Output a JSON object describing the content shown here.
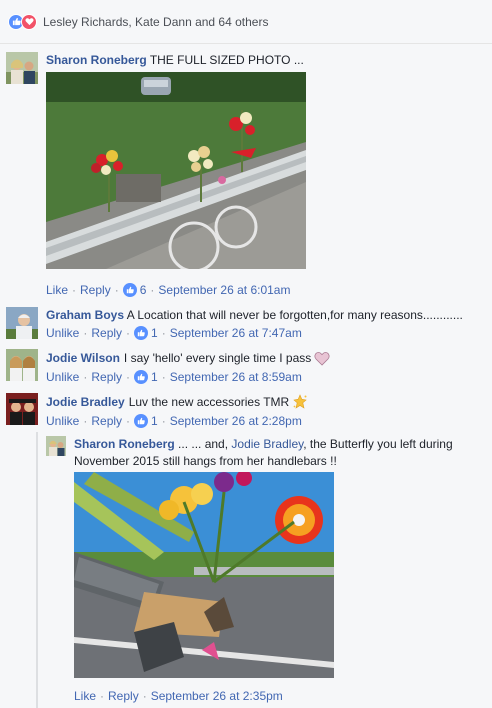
{
  "reactions": {
    "text": "Lesley Richards, Kate Dann and 64 others"
  },
  "comments": [
    {
      "author": "Sharon Roneberg",
      "text": "THE FULL SIZED PHOTO ...",
      "actions": {
        "like": "Like",
        "reply": "Reply",
        "likes": "6",
        "time": "September 26 at 6:01am"
      }
    },
    {
      "author": "Graham Boys",
      "text": "A Location that will never be forgotten,for many reasons............",
      "actions": {
        "like": "Unlike",
        "reply": "Reply",
        "likes": "1",
        "time": "September 26 at 7:47am"
      }
    },
    {
      "author": "Jodie Wilson",
      "text": "I say 'hello' every single time I pass",
      "emoji": "heart",
      "actions": {
        "like": "Unlike",
        "reply": "Reply",
        "likes": "1",
        "time": "September 26 at 8:59am"
      }
    },
    {
      "author": "Jodie Bradley",
      "text": "Luv the new accessories TMR",
      "emoji": "sparkle-star",
      "actions": {
        "like": "Unlike",
        "reply": "Reply",
        "likes": "1",
        "time": "September 26 at 2:28pm"
      }
    }
  ],
  "reply": {
    "author": "Sharon Roneberg",
    "text_before": "... ... and,",
    "mention": "Jodie Bradley",
    "text_after": ", the Butterfly you left during",
    "text_line2": "November 2015 still hangs from her handlebars !!",
    "actions": {
      "like": "Like",
      "reply": "Reply",
      "time": "September 26 at 2:35pm"
    }
  },
  "colors": {
    "link": "#365899",
    "action": "#4267b2",
    "meta": "#90949c",
    "like_blue": "#5890ff",
    "love_red": "#f25268"
  }
}
